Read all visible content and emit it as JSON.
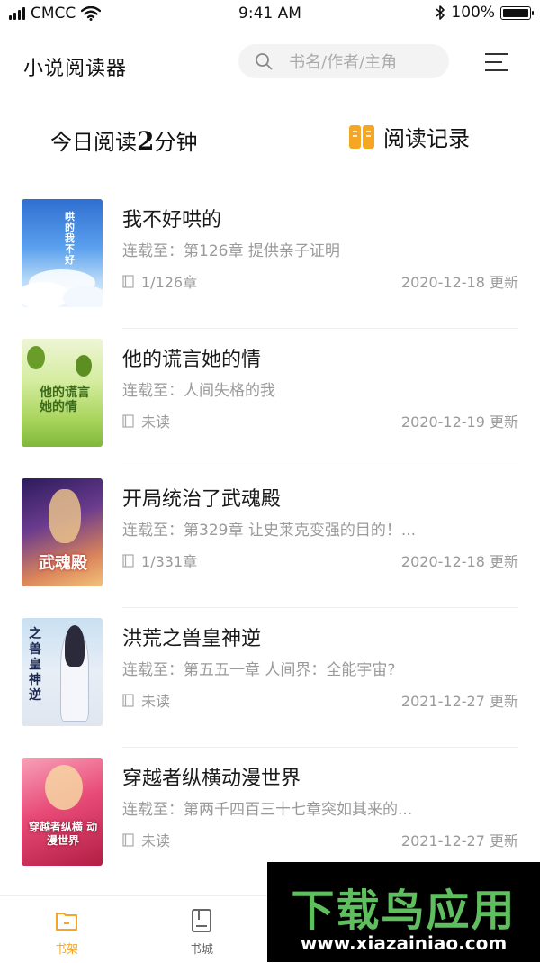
{
  "status_bar": {
    "carrier": "CMCC",
    "time": "9:41 AM",
    "battery": "100%"
  },
  "header": {
    "title": "小说阅读器",
    "search_placeholder": "书名/作者/主角"
  },
  "reading": {
    "prefix": "今日阅读",
    "minutes": "2",
    "suffix": "分钟",
    "history_label": "阅读记录"
  },
  "colors": {
    "accent": "#f5a623",
    "text_primary": "#1a1a1a",
    "text_secondary": "#9a9a9a"
  },
  "books": [
    {
      "title": "我不好哄的",
      "latest": "连载至：第126章 提供亲子证明",
      "progress": "1/126章",
      "updated": "2020-12-18 更新",
      "cover_text": "哄的 我不好"
    },
    {
      "title": "他的谎言她的情",
      "latest": "连载至：人间失格的我",
      "progress": "未读",
      "updated": "2020-12-19 更新",
      "cover_text": "他的谎言 她的情"
    },
    {
      "title": "开局统治了武魂殿",
      "latest": "连载至：第329章 让史莱克变强的目的！...",
      "progress": "1/331章",
      "updated": "2020-12-18 更新",
      "cover_text": "武魂殿"
    },
    {
      "title": "洪荒之兽皇神逆",
      "latest": "连载至：第五五一章 人间界：全能宇宙?",
      "progress": "未读",
      "updated": "2021-12-27 更新",
      "cover_text": "之兽皇神逆"
    },
    {
      "title": "穿越者纵横动漫世界",
      "latest": "连载至：第两千四百三十七章突如其来的...",
      "progress": "未读",
      "updated": "2021-12-27 更新",
      "cover_text": "穿越者纵横 动漫世界"
    }
  ],
  "bottom_nav": {
    "shelf_label": "书架",
    "store_label": "书城"
  },
  "watermark": {
    "big": "下载鸟应用",
    "small": "www.xiazainiao.com"
  }
}
